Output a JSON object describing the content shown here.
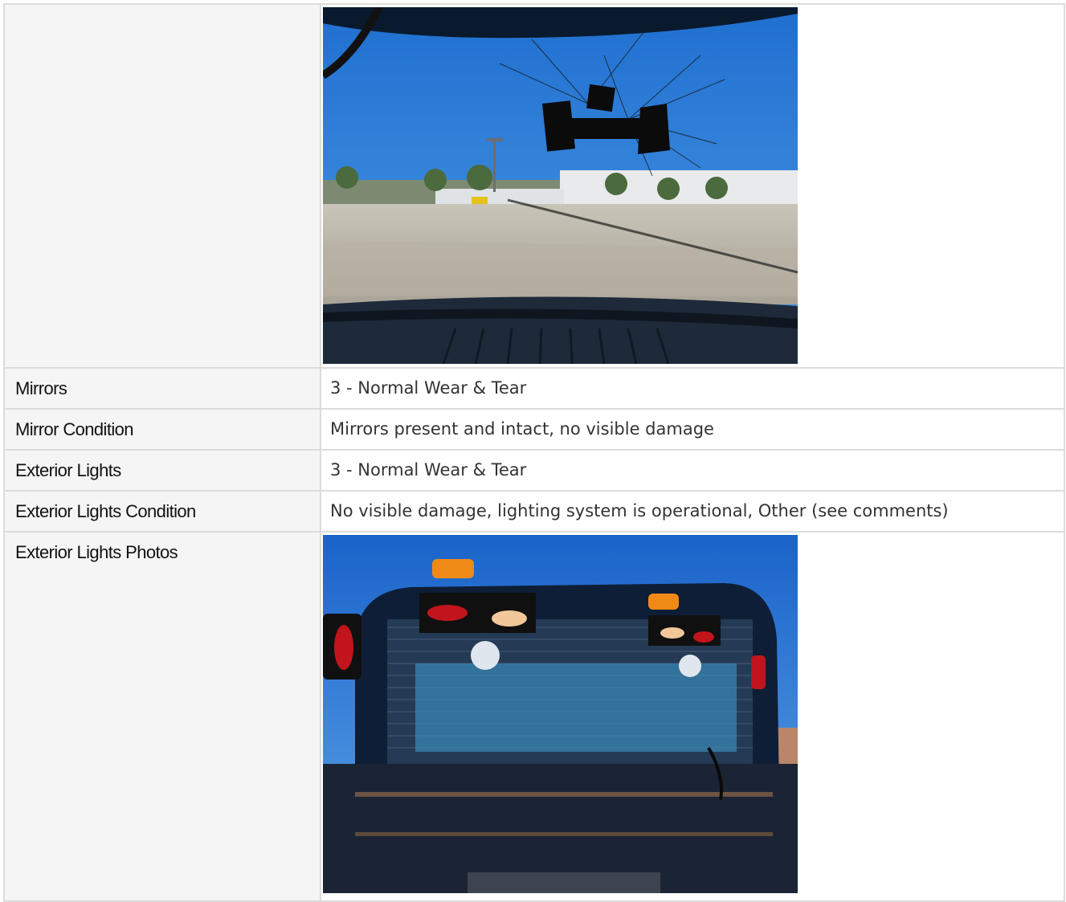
{
  "rows": [
    {
      "label": "",
      "type": "photo",
      "photo_icon": "windshield-crack-photo"
    },
    {
      "label": "Mirrors",
      "type": "text",
      "value": "3 - Normal Wear & Tear"
    },
    {
      "label": "Mirror Condition",
      "type": "text",
      "value": "Mirrors present and intact, no visible damage"
    },
    {
      "label": "Exterior Lights",
      "type": "text",
      "value": "3 - Normal Wear & Tear"
    },
    {
      "label": "Exterior Lights Condition",
      "type": "text",
      "value": "No visible damage, lighting system is operational, Other (see comments)"
    },
    {
      "label": "Exterior Lights Photos",
      "type": "photo",
      "photo_icon": "truck-headache-rack-lights-photo"
    }
  ],
  "colors": {
    "label_bg": "#f5f5f5",
    "border": "#dcdcdc",
    "sky": "#2f7fd8"
  }
}
